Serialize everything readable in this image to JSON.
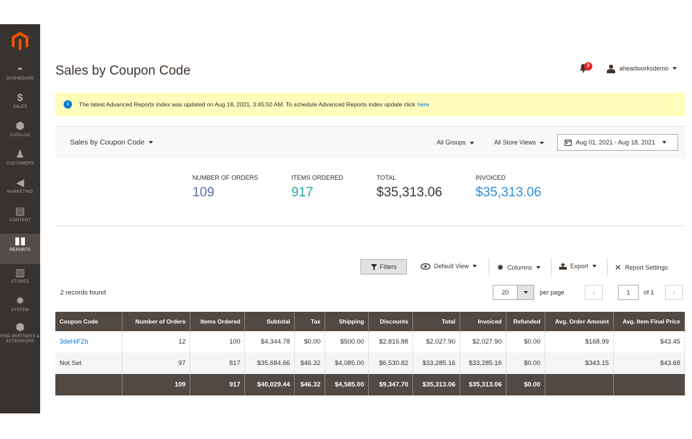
{
  "sidebar": {
    "logo": "magento-logo",
    "items": [
      {
        "icon": "dashboard-icon",
        "label": "DASHBOARD"
      },
      {
        "icon": "dollar-icon",
        "label": "SALES"
      },
      {
        "icon": "cube-icon",
        "label": "CATALOG"
      },
      {
        "icon": "person-icon",
        "label": "CUSTOMERS"
      },
      {
        "icon": "megaphone-icon",
        "label": "MARKETING"
      },
      {
        "icon": "content-icon",
        "label": "CONTENT"
      },
      {
        "icon": "bar-chart-icon",
        "label": "REPORTS"
      },
      {
        "icon": "store-icon",
        "label": "STORES"
      },
      {
        "icon": "gear-icon",
        "label": "SYSTEM"
      },
      {
        "icon": "partners-icon",
        "label": "FIND PARTNERS & EXTENSIONS"
      }
    ],
    "active": "REPORTS"
  },
  "header": {
    "title": "Sales by Coupon Code",
    "notification_count": "3",
    "user": "aheadworksdemo"
  },
  "notice": {
    "text": "The latest Advanced Reports index was updated on Aug 18, 2021, 3:45:50 AM. To schedule Advanced Reports index update click",
    "link": "here"
  },
  "report_bar": {
    "report": "Sales by Coupon Code",
    "groups": "All Groups",
    "store_views": "All Store Views",
    "date_range": "Aug 01, 2021 - Aug 18, 2021"
  },
  "totals": [
    {
      "label": "NUMBER OF ORDERS",
      "value": "109"
    },
    {
      "label": "ITEMS ORDERED",
      "value": "917"
    },
    {
      "label": "TOTAL",
      "value": "$35,313.06"
    },
    {
      "label": "INVOICED",
      "value": "$35,313.06"
    }
  ],
  "toolbar": {
    "filters": "Filters",
    "default_view": "Default View",
    "columns": "Columns",
    "export": "Export",
    "report_settings": "Report Settings"
  },
  "grid": {
    "records_found": "2 records found",
    "per_page_value": "20",
    "per_page_label": "per page",
    "page": "1",
    "of_pages": "of 1",
    "columns": [
      "Coupon Code",
      "Number of Orders",
      "Items Ordered",
      "Subtotal",
      "Tax",
      "Shipping",
      "Discounts",
      "Total",
      "Invoiced",
      "Refunded",
      "Avg. Order Amount",
      "Avg. Item Final Price"
    ],
    "rows": [
      [
        "3deHiFZh",
        "12",
        "100",
        "$4,344.78",
        "$0.00",
        "$500.00",
        "$2,816.88",
        "$2,027.90",
        "$2,027.90",
        "$0.00",
        "$168.99",
        "$43.45"
      ],
      [
        "Not Set",
        "97",
        "817",
        "$35,684.66",
        "$46.32",
        "$4,085.00",
        "$6,530.82",
        "$33,285.16",
        "$33,285.16",
        "$0.00",
        "$343.15",
        "$43.68"
      ]
    ],
    "totals_row": [
      "",
      "109",
      "917",
      "$40,029.44",
      "$46.32",
      "$4,585.00",
      "$9,347.70",
      "$35,313.06",
      "$35,313.06",
      "$0.00",
      "",
      ""
    ]
  },
  "colors": {
    "sidebar": "#373330",
    "header_row": "#514943",
    "notice_bg": "#fffbbb",
    "link": "#007bdb",
    "accent_orange": "#eb5202"
  }
}
